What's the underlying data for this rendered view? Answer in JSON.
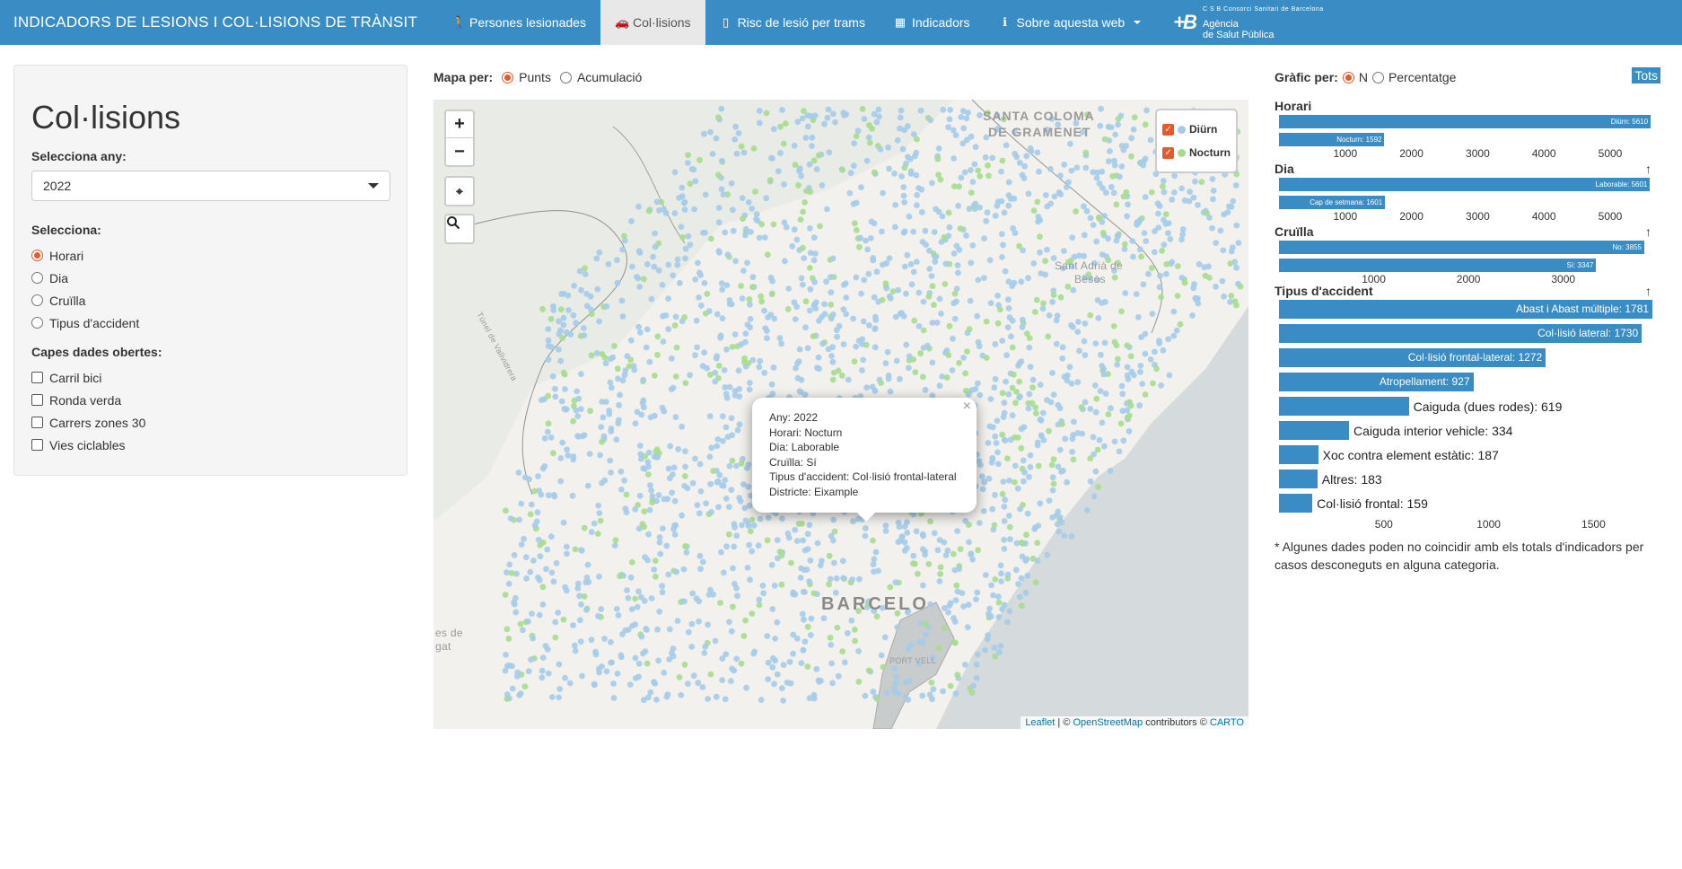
{
  "navbar": {
    "brand": "INDICADORS DE LESIONS I COL·LISIONS DE TRÀNSIT",
    "items": [
      {
        "label": "Persones lesionades",
        "icon": "person-icon"
      },
      {
        "label": "Col·lisions",
        "icon": "car-icon",
        "active": true
      },
      {
        "label": "Risc de lesió per trams",
        "icon": "map-icon"
      },
      {
        "label": "Indicadors",
        "icon": "table-icon"
      },
      {
        "label": "Sobre aquesta web",
        "icon": "info-icon"
      }
    ],
    "logo": {
      "csb": "C S B   Consorci Sanitari de Barcelona",
      "line1": "Agència",
      "line2": "de Salut Pública"
    }
  },
  "sidebar": {
    "title": "Col·lisions",
    "year_label": "Selecciona any:",
    "year_value": "2022",
    "select_label": "Selecciona:",
    "options": [
      "Horari",
      "Dia",
      "Cruïlla",
      "Tipus d'accident"
    ],
    "selected_option": "Horari",
    "layers_label": "Capes dades obertes:",
    "layers": [
      "Carril bici",
      "Ronda verda",
      "Carrers zones 30",
      "Vies ciclables"
    ]
  },
  "map": {
    "mode_label": "Mapa per:",
    "modes": [
      "Punts",
      "Acumulació"
    ],
    "selected_mode": "Punts",
    "legend": [
      {
        "label": "Diürn",
        "color": "#a6cbe8"
      },
      {
        "label": "Nocturn",
        "color": "#a7dc8f"
      }
    ],
    "place_labels": [
      "SANTA COLOMA",
      "DE GRAMENET",
      "Sant Adrià de",
      "Besòs",
      "BARCELO",
      "PORT VELL",
      "Túnel de Vallvidrera",
      "es de",
      "gat"
    ],
    "popup": {
      "lines": [
        "Any: 2022",
        "Horari: Nocturn",
        "Dia: Laborable",
        "Cruïlla: Sí",
        "Tipus d'accident: Col·lisió frontal-lateral",
        "Districte: Eixample"
      ]
    },
    "attribution": {
      "leaflet": "Leaflet",
      "sep": " | © ",
      "osm": "OpenStreetMap",
      "contrib": " contributors © ",
      "carto": "CARTO"
    }
  },
  "charts": {
    "mode_label": "Gràfic per:",
    "modes": [
      "N",
      "Percentatge"
    ],
    "selected_mode": "N",
    "tots_label": "Tots",
    "note": "* Algunes dades poden no coincidir amb els totals d'indicadors per casos desconeguts en alguna categoria.",
    "colors": {
      "bar": "#3a8dc4"
    }
  },
  "chart_data": [
    {
      "type": "bar",
      "title": "Horari",
      "orientation": "horizontal",
      "categories": [
        "Diürn",
        "Nocturn"
      ],
      "values": [
        5610,
        1592
      ],
      "labels": [
        "Diürn: 5610",
        "Nocturn: 1592"
      ],
      "ticks": [
        1000,
        2000,
        3000,
        4000,
        5000
      ],
      "xlim": [
        0,
        5650
      ]
    },
    {
      "type": "bar",
      "title": "Dia",
      "orientation": "horizontal",
      "categories": [
        "Laborable",
        "Cap de setmana"
      ],
      "values": [
        5601,
        1601
      ],
      "labels": [
        "Laborable: 5601",
        "Cap de setmana: 1601"
      ],
      "ticks": [
        1000,
        2000,
        3000,
        4000,
        5000
      ],
      "xlim": [
        0,
        5650
      ]
    },
    {
      "type": "bar",
      "title": "Cruïlla",
      "orientation": "horizontal",
      "categories": [
        "No",
        "Sí"
      ],
      "values": [
        3855,
        3347
      ],
      "labels": [
        "No: 3855",
        "Sí: 3347"
      ],
      "ticks": [
        1000,
        2000,
        3000
      ],
      "xlim": [
        0,
        3950
      ]
    },
    {
      "type": "bar",
      "title": "Tipus d'accident",
      "orientation": "horizontal",
      "categories": [
        "Abast i Abast múltiple",
        "Col·lisió lateral",
        "Col·lisió frontal-lateral",
        "Atropellament",
        "Caiguda (dues rodes)",
        "Caiguda interior vehicle",
        "Xoc contra element estàtic",
        "Altres",
        "Col·lisió frontal"
      ],
      "values": [
        1781,
        1730,
        1272,
        927,
        619,
        334,
        187,
        183,
        159
      ],
      "labels": [
        "Abast i Abast múltiple: 1781",
        "Col·lisió lateral: 1730",
        "Col·lisió frontal-lateral: 1272",
        "Atropellament: 927",
        "Caiguda (dues rodes): 619",
        "Caiguda interior vehicle: 334",
        "Xoc contra element estàtic: 187",
        "Altres: 183",
        "Col·lisió frontal: 159"
      ],
      "ticks": [
        500,
        1000,
        1500
      ],
      "xlim": [
        0,
        1785
      ]
    }
  ]
}
